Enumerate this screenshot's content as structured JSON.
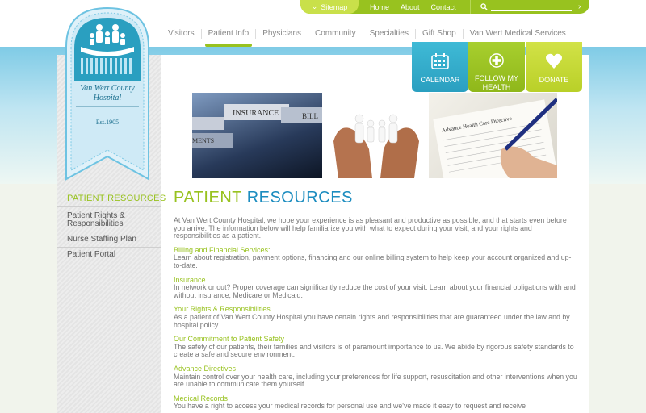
{
  "utility_bar": {
    "sitemap_label": "Sitemap",
    "links": [
      "Home",
      "About",
      "Contact"
    ],
    "search_placeholder": ""
  },
  "nav": {
    "items": [
      "Visitors",
      "Patient Info",
      "Physicians",
      "Community",
      "Specialties",
      "Gift Shop",
      "Van Wert Medical Services"
    ],
    "active": "Patient Info"
  },
  "logo": {
    "name_line1": "Van Wert County",
    "name_line2": "Hospital",
    "established": "Est.1905"
  },
  "tiles": {
    "calendar": "CALENDAR",
    "follow_health_line1": "FOLLOW MY",
    "follow_health_line2": "HEALTH",
    "donate": "DONATE"
  },
  "sidebar": {
    "title": "PATIENT RESOURCES",
    "items": [
      "Patient Rights &",
      "Responsibilities",
      "Nurse Staffing Plan",
      "Patient Portal"
    ]
  },
  "photos": {
    "insurance_tab": "INSURANCE",
    "insurance_tab2": "BILL",
    "insurance_tab3": "MENTS",
    "form_heading": "Advance Health Care Directive"
  },
  "page": {
    "title_part1": "PATIENT",
    "title_part2": "RESOURCES",
    "intro": "At Van Wert County Hospital, we hope your experience is as pleasant and productive as possible, and that starts even before you arrive. The information below will help familiarize you with what to expect during your visit, and your rights and responsibilities as a patient.",
    "sections": [
      {
        "heading": "Billing and Financial Services:",
        "body": "Learn about registration, payment options, financing and our online billing system to help keep your account organized and up-to-date."
      },
      {
        "heading": "Insurance",
        "body": "In network or out? Proper coverage can significantly reduce the cost of your visit. Learn about your financial obligations with and without insurance, Medicare or Medicaid."
      },
      {
        "heading": "Your Rights & Responsibilities",
        "body": "As a patient of Van Wert County Hospital you have certain rights and responsibilities that are guaranteed under the law and by hospital policy."
      },
      {
        "heading": "Our Commitment to Patient Safety",
        "body": "The safety of our patients, their families and visitors is of paramount importance to us. We abide by rigorous safety standards to create a safe and secure environment."
      },
      {
        "heading": "Advance Directives",
        "body": "Maintain control over your health care, including your preferences for life support, resuscitation and other interventions when you are unable to communicate them yourself."
      },
      {
        "heading": "Medical Records",
        "body": "You have a right to access your medical records for personal use and we've made it easy to request and receive"
      }
    ]
  },
  "colors": {
    "accent_green": "#98c21f",
    "accent_blue": "#1b8cbf",
    "calendar_tile": "#2a9fc0",
    "donate_tile": "#c5da34"
  }
}
